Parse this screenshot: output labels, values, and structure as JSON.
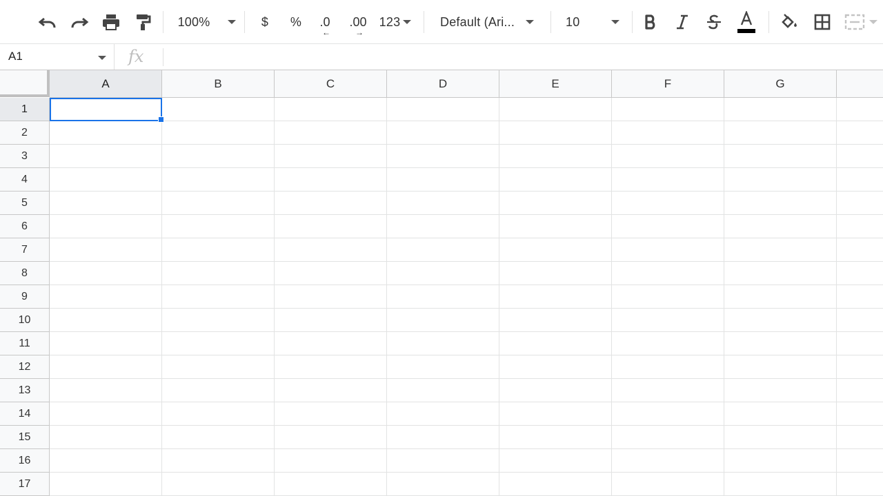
{
  "toolbar": {
    "zoom": "100%",
    "currency_label": "$",
    "percent_label": "%",
    "decrease_decimal_label": ".0",
    "increase_decimal_label": ".00",
    "number_format_label": "123",
    "font_family": "Default (Ari...",
    "font_size": "10",
    "icons": [
      "undo-icon",
      "redo-icon",
      "print-icon",
      "paint-format-icon",
      "bold-icon",
      "italic-icon",
      "strikethrough-icon",
      "text-color-icon",
      "fill-color-icon",
      "borders-icon",
      "merge-cells-icon"
    ],
    "text_color": "#000000"
  },
  "formula_bar": {
    "cell_ref": "A1",
    "fx_label": "fx",
    "value": ""
  },
  "sheet": {
    "columns": [
      "A",
      "B",
      "C",
      "D",
      "E",
      "F",
      "G"
    ],
    "rows": [
      "1",
      "2",
      "3",
      "4",
      "5",
      "6",
      "7",
      "8",
      "9",
      "10",
      "11",
      "12",
      "13",
      "14",
      "15",
      "16",
      "17"
    ],
    "selected_cell": "A1",
    "selection_color": "#1a73e8"
  }
}
